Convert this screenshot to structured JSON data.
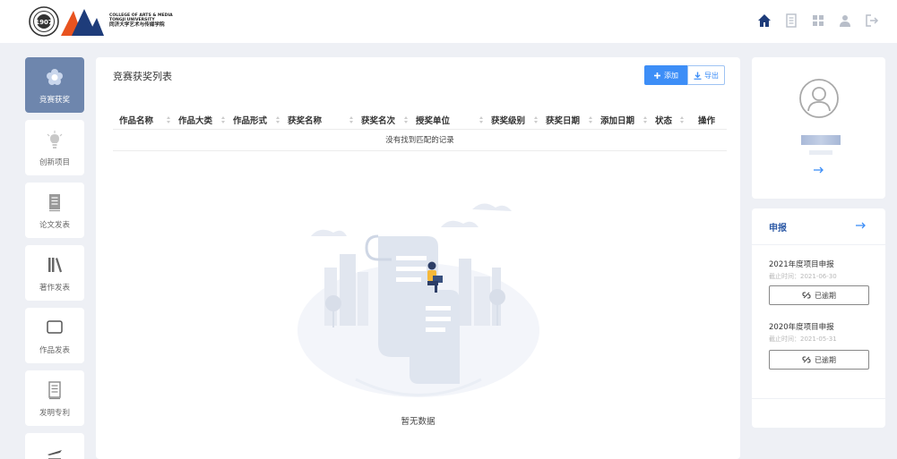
{
  "brand": {
    "line1": "COLLEGE OF ARTS & MEDIA",
    "line2": "TONGJI UNIVERSITY",
    "line3": "同济大学艺术与传媒学院"
  },
  "header_icons": [
    "home-icon",
    "document-icon",
    "grid-icon",
    "user-icon",
    "logout-icon"
  ],
  "sidebar": {
    "items": [
      {
        "label": "竞赛获奖",
        "icon": "award-flower-icon",
        "active": true
      },
      {
        "label": "创新项目",
        "icon": "lightbulb-icon",
        "active": false
      },
      {
        "label": "论文发表",
        "icon": "paper-icon",
        "active": false
      },
      {
        "label": "著作发表",
        "icon": "books-icon",
        "active": false
      },
      {
        "label": "作品发表",
        "icon": "frame-icon",
        "active": false
      },
      {
        "label": "发明专利",
        "icon": "patent-icon",
        "active": false
      },
      {
        "label": "",
        "icon": "plane-icon",
        "active": false
      }
    ]
  },
  "main": {
    "title": "竞赛获奖列表",
    "add_label": "添加",
    "export_label": "导出",
    "columns": [
      "作品名称",
      "作品大类",
      "作品形式",
      "获奖名称",
      "获奖名次",
      "授奖单位",
      "获奖级别",
      "获奖日期",
      "添加日期",
      "状态",
      "操作"
    ],
    "empty_row": "没有找到匹配的记录",
    "empty_state": "暂无数据"
  },
  "apply": {
    "title": "申报",
    "projects": [
      {
        "title": "2021年度项目申报",
        "deadline": "截止时间：2021-06-30",
        "status": "已逾期"
      },
      {
        "title": "2020年度项目申报",
        "deadline": "截止时间：2021-05-31",
        "status": "已逾期"
      }
    ]
  },
  "colors": {
    "accent": "#3d8ef7",
    "sidebar_active": "#6e86ad",
    "apply_title": "#2d5aa6",
    "background": "#eef0f5"
  }
}
